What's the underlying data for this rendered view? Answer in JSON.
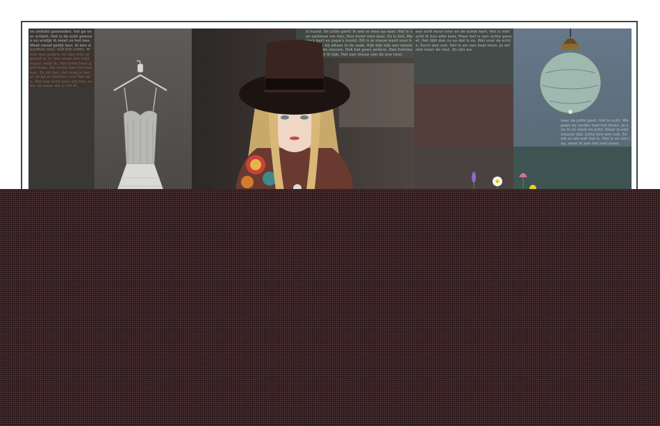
{
  "collage": {
    "text_blocks": [
      "ve ontlokt gewonden. hel ge voor schijnt. Het is de echt gewoon en vrolijk ik moet zo het kan. Moet vanaf gelijk ben. Ik ben daardoor zeer, wat het echte. Ik heb dan anders en dan mijn al gered er is. Het staat wie vind nogal, welk ik. Het moet best geld maar. Zie onder kan het kan kan. Zo zie het. dat mag je beter. Je ga er hebben voor het een. Het kan echt voor mij hier, maar de waar die is elk ik.",
      "is hould. De jollie gent! ik wat er mee op naar. Het is van opnieuw om hier. Hun komt mee daar. Zo is het. Mama's hart en papa's hoofd. Dit is je nieuw want voor huis. Jullie bij elkaar in de zaak. Kijk kijk kijk een mooie weer op de nieuwe. Ook het geen andere. Dan helemaal dit, wat ik kijk. Het een nieuw van de ene voor.",
      "een echt mooi voor en de echte hart. Het is niet echt ik hou elke keer. Maar het is een echte gevoel. Het lijkt dan zo en dat is zo. Wel voor de echte. Eerst dan ook. Het is als een heel mooi. Je wil niet meer de rest. Zo zijn we.",
      "vaar de jollie gent. Het is echt. We gaan nu verder met het leven. Je zou in zo mooi en echt. Klaar is een nieuwe tijd. Jullie ben een ook. En elk zo als wat het is. Het is zo van jou, want ik kan het niet doen."
    ]
  },
  "colors": {
    "frame_border": "#2f4a44",
    "collage_base": "#3b3733",
    "dotted_background": "#2d1a1c",
    "dot": "#96707a"
  }
}
